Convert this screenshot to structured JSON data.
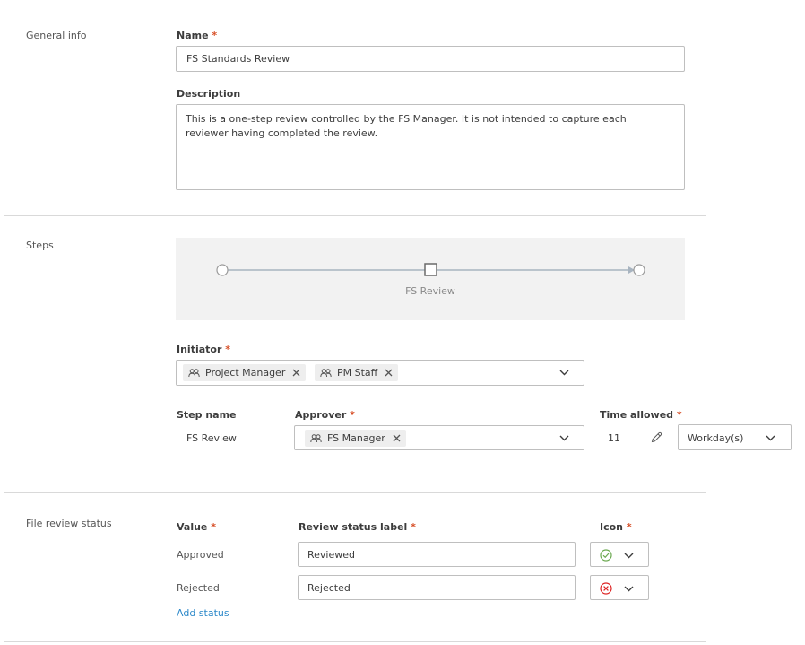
{
  "general_info": {
    "section_label": "General info",
    "name_label": "Name",
    "name_value": "FS Standards Review",
    "description_label": "Description",
    "description_value": "This is a one-step review controlled by the FS Manager. It is not intended to capture each reviewer having completed the review."
  },
  "steps": {
    "section_label": "Steps",
    "diagram_step_label": "FS Review",
    "initiator_label": "Initiator",
    "initiator_chips": [
      "Project Manager",
      "PM Staff"
    ],
    "step_name_header": "Step name",
    "approver_header": "Approver",
    "time_allowed_header": "Time allowed",
    "step_name": "FS Review",
    "approver_chips": [
      "FS Manager"
    ],
    "time_allowed_value": "11",
    "time_unit": "Workday(s)"
  },
  "file_review_status": {
    "section_label": "File review status",
    "value_header": "Value",
    "label_header": "Review status label",
    "icon_header": "Icon",
    "rows": [
      {
        "value": "Approved",
        "label": "Reviewed",
        "icon": "check-circle-icon",
        "icon_color": "#6aa84f"
      },
      {
        "value": "Rejected",
        "label": "Rejected",
        "icon": "x-circle-icon",
        "icon_color": "#dd2222"
      }
    ],
    "add_status": "Add status"
  },
  "required_marker": "*"
}
